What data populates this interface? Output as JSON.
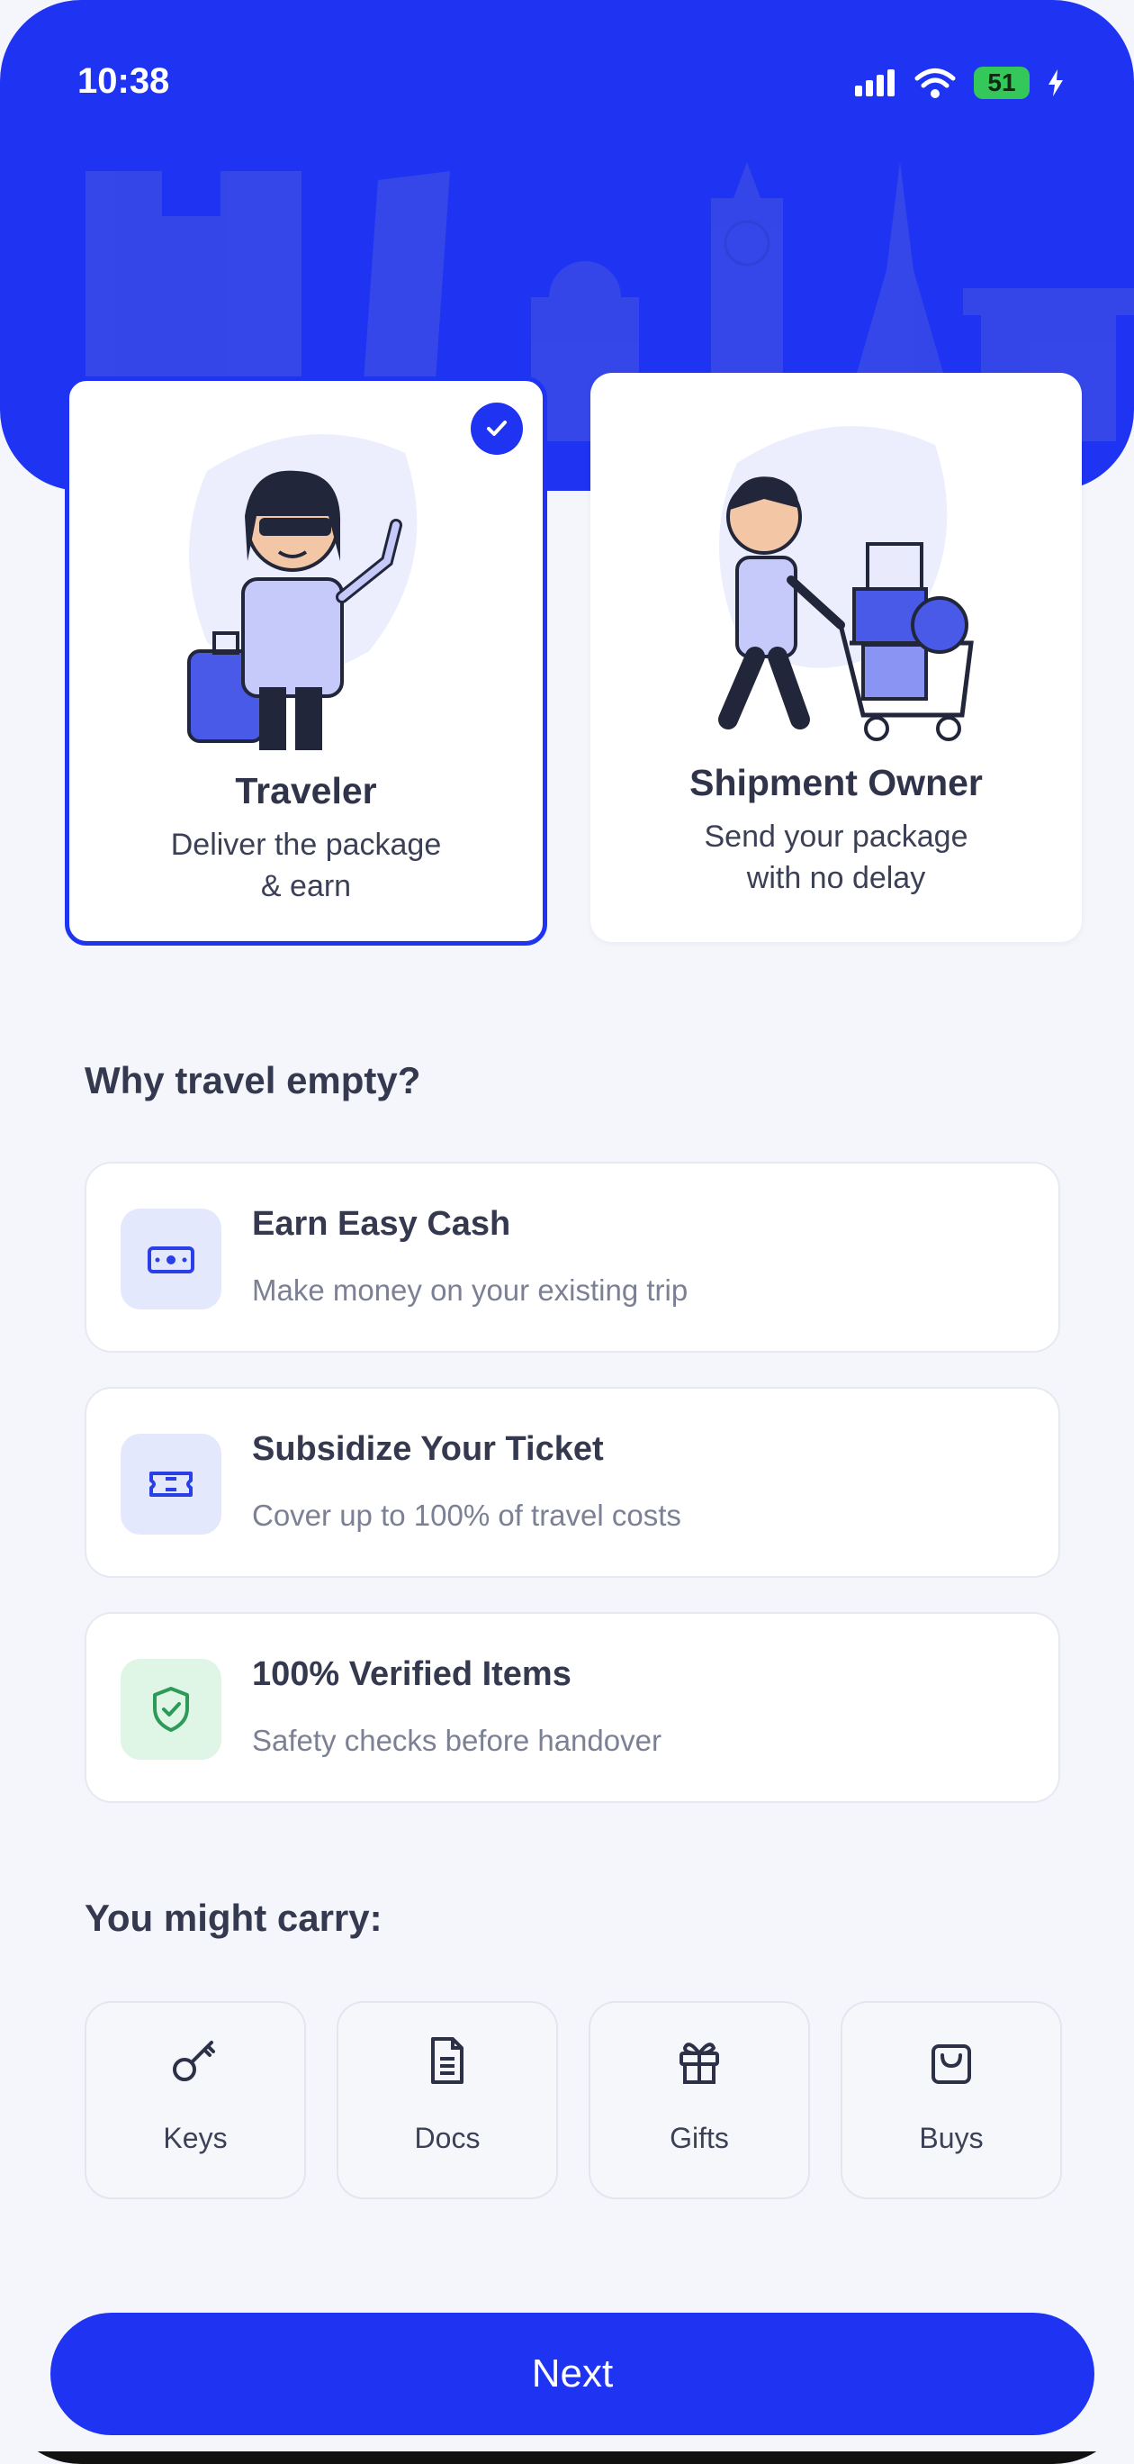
{
  "status_bar": {
    "time": "10:38",
    "battery": "51"
  },
  "roles": [
    {
      "title": "Traveler",
      "subtitle_line1": "Deliver the package",
      "subtitle_line2": "& earn",
      "selected": true
    },
    {
      "title": "Shipment Owner",
      "subtitle_line1": "Send your package",
      "subtitle_line2": "with no delay",
      "selected": false
    }
  ],
  "why_section": {
    "title": "Why travel empty?",
    "items": [
      {
        "title": "Earn Easy Cash",
        "subtitle": "Make money on your existing trip",
        "icon": "cash-icon"
      },
      {
        "title": "Subsidize Your Ticket",
        "subtitle": "Cover up to 100% of travel costs",
        "icon": "ticket-icon"
      },
      {
        "title": "100% Verified Items",
        "subtitle": "Safety checks before handover",
        "icon": "shield-check-icon"
      }
    ]
  },
  "carry_section": {
    "title": "You might carry:",
    "items": [
      {
        "label": "Keys",
        "icon": "key-icon"
      },
      {
        "label": "Docs",
        "icon": "document-icon"
      },
      {
        "label": "Gifts",
        "icon": "gift-icon"
      },
      {
        "label": "Buys",
        "icon": "shopping-bag-icon"
      }
    ]
  },
  "next_button": {
    "label": "Next"
  },
  "colors": {
    "primary": "#1f34f2",
    "background": "#f4f6fb",
    "benefit_icon_bg": "#e3e8fd",
    "verified_icon_bg": "#dff5e6",
    "verified_icon": "#2e9a57"
  }
}
